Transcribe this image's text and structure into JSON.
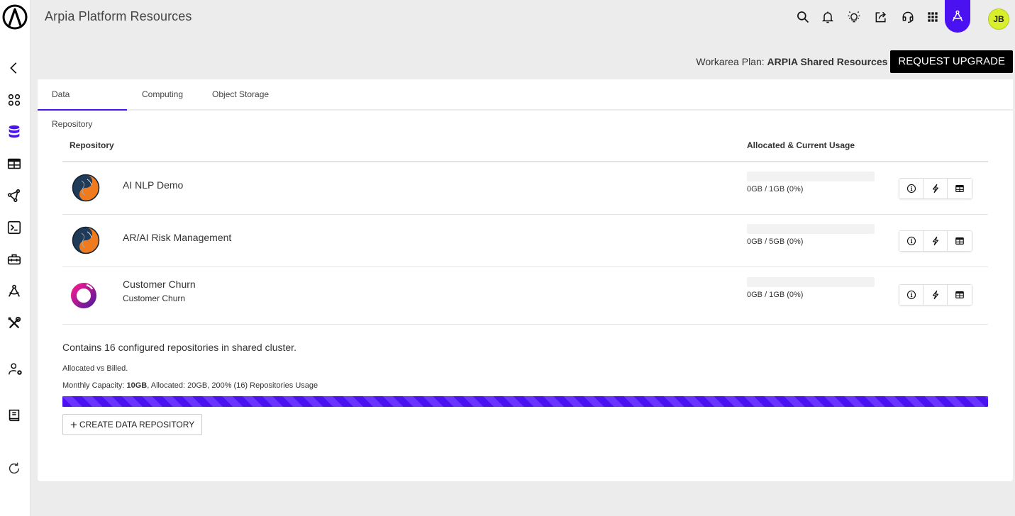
{
  "app": {
    "title": "Arpia Platform Resources"
  },
  "colors": {
    "accent": "#4a12f0",
    "avatar_bg": "#d9ef2b",
    "button_dark": "#000000"
  },
  "topbar": {
    "icons": [
      "search-icon",
      "bell-icon",
      "lightbulb-icon",
      "share-icon",
      "headset-icon",
      "apps-grid-icon",
      "compass-icon"
    ],
    "active_app": "compass-icon",
    "user_initials": "JB"
  },
  "sidebar": {
    "items": [
      {
        "name": "back",
        "icon": "chevron-left-icon"
      },
      {
        "name": "apps",
        "icon": "grid-circles-icon"
      },
      {
        "name": "data-repository",
        "icon": "database-icon",
        "active": true
      },
      {
        "name": "tables",
        "icon": "table-icon"
      },
      {
        "name": "pipelines",
        "icon": "graph-nodes-icon"
      },
      {
        "name": "terminal",
        "icon": "terminal-icon"
      },
      {
        "name": "toolbox",
        "icon": "toolbox-icon"
      },
      {
        "name": "design",
        "icon": "compass-icon"
      },
      {
        "name": "tools",
        "icon": "tools-icon"
      },
      {
        "name": "user-settings",
        "icon": "user-gear-icon"
      },
      {
        "name": "documentation",
        "icon": "book-icon"
      },
      {
        "name": "refresh",
        "icon": "refresh-icon"
      }
    ]
  },
  "plan": {
    "label": "Workarea Plan:",
    "value": "ARPIA Shared Resources",
    "upgrade_button": "REQUEST UPGRADE"
  },
  "tabs": [
    {
      "label": "Data Repository",
      "active": true
    },
    {
      "label": "Computing",
      "active": false
    },
    {
      "label": "Object Storage",
      "active": false
    }
  ],
  "table": {
    "headers": {
      "repository": "Repository",
      "usage": "Allocated & Current Usage"
    },
    "rows": [
      {
        "name": "AI NLP Demo",
        "subtitle": "",
        "logo": "mysql-logo",
        "usage_text": "0GB / 1GB (0%)",
        "usage_pct": 0,
        "actions": [
          "info-icon",
          "lightning-icon",
          "table-icon"
        ]
      },
      {
        "name": "AR/AI Risk Management",
        "subtitle": "",
        "logo": "mysql-logo",
        "usage_text": "0GB / 5GB (0%)",
        "usage_pct": 0,
        "actions": [
          "info-icon",
          "lightning-icon",
          "table-icon"
        ]
      },
      {
        "name": "Customer Churn",
        "subtitle": "Customer Churn",
        "logo": "ring-logo",
        "usage_text": "0GB / 1GB (0%)",
        "usage_pct": 0,
        "actions": [
          "info-icon",
          "lightning-icon",
          "table-icon"
        ]
      }
    ]
  },
  "summary": {
    "title": "Contains 16 configured repositories in shared cluster.",
    "allocated_vs_billed": "Allocated vs Billed.",
    "capacity_prefix": "Monthly Capacity: ",
    "capacity_value": "10GB",
    "capacity_suffix": ", Allocated: 20GB, 200% (16) Repositories Usage",
    "capacity_pct": 200,
    "create_button": "CREATE DATA REPOSITORY",
    "create_plus": "+"
  }
}
